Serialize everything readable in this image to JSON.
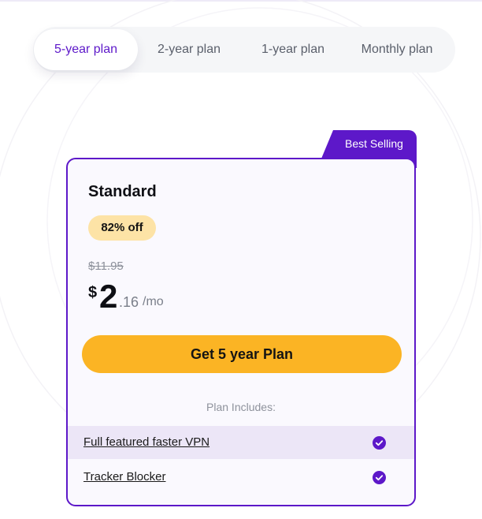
{
  "plan_tabs": [
    {
      "label": "5-year plan",
      "active": true
    },
    {
      "label": "2-year plan",
      "active": false
    },
    {
      "label": "1-year plan",
      "active": false
    },
    {
      "label": "Monthly plan",
      "active": false
    }
  ],
  "card": {
    "ribbon": "Best Selling",
    "title": "Standard",
    "discount": "82% off",
    "old_price": "$11.95",
    "price": {
      "currency": "$",
      "whole": "2",
      "cents": ".16",
      "period": "/mo"
    },
    "cta_label": "Get 5 year Plan",
    "includes_heading": "Plan Includes:",
    "features": [
      {
        "label": "Full featured faster VPN",
        "icon": "check-circle-icon",
        "highlighted": true
      },
      {
        "label": "Tracker Blocker",
        "icon": "check-circle-icon",
        "highlighted": false
      }
    ]
  },
  "colors": {
    "accent": "#5d18c9",
    "cta": "#fbb424",
    "badge": "#fde3a6",
    "highlight_row": "#ece6f7"
  }
}
